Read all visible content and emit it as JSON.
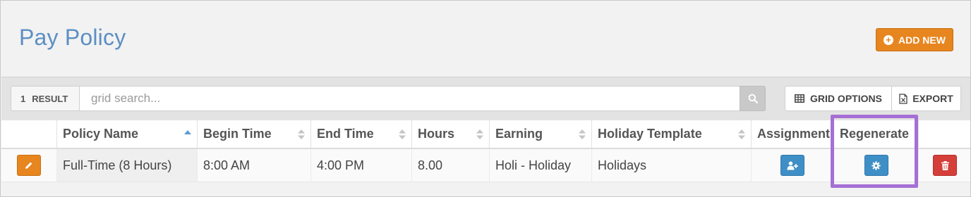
{
  "header": {
    "page_title": "Pay Policy",
    "add_new_label": "ADD NEW"
  },
  "toolbar": {
    "result_count": "1",
    "result_label": "RESULT",
    "search_placeholder": "grid search...",
    "grid_options_label": "GRID OPTIONS",
    "export_label": "EXPORT"
  },
  "table": {
    "columns": [
      "Policy Name",
      "Begin Time",
      "End Time",
      "Hours",
      "Earning",
      "Holiday Template",
      "Assignment",
      "Regenerate"
    ],
    "sorted_column": "Policy Name",
    "sort_direction": "ascending",
    "rows": [
      {
        "policy_name": "Full-Time (8 Hours)",
        "begin_time": "8:00 AM",
        "end_time": "4:00 PM",
        "hours": "8.00",
        "earning": "Holi - Holiday",
        "holiday_template": "Holidays"
      }
    ]
  },
  "icons": {
    "add": "plus-circle-icon",
    "search": "search-icon",
    "grid": "table-grid-icon",
    "export": "excel-file-icon",
    "edit": "pencil-icon",
    "assign": "user-plus-icon",
    "regenerate": "gear-icon",
    "delete": "trash-icon"
  },
  "colors": {
    "title": "#5b8fc3",
    "accent_orange": "#e7851f",
    "primary_blue": "#3f8fc7",
    "danger_red": "#d43f3a",
    "highlight_purple": "#a66fd6"
  }
}
